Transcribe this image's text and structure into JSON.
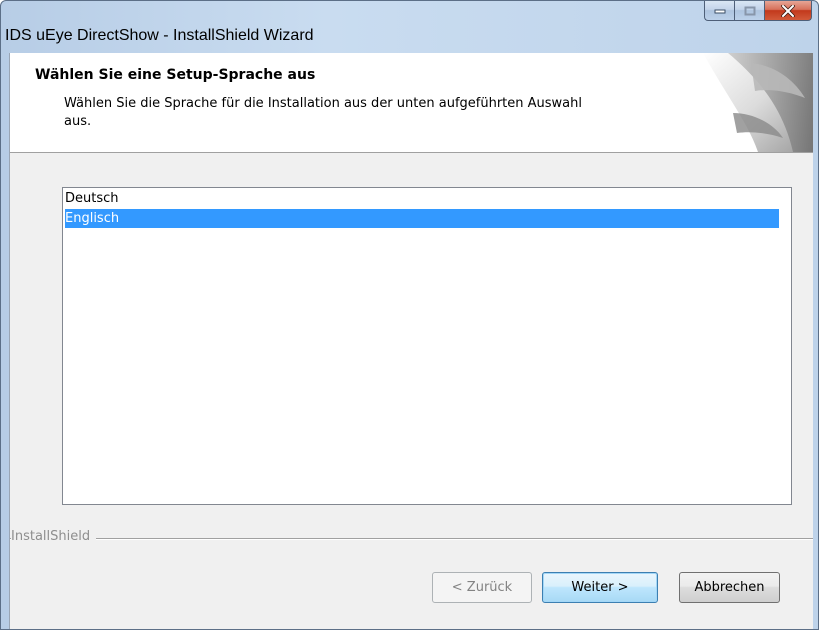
{
  "window": {
    "title": "IDS uEye DirectShow - InstallShield Wizard",
    "buttons": {
      "minimize": "minimize-icon",
      "maximize": "maximize-icon",
      "close": "close-icon"
    }
  },
  "header": {
    "title": "Wählen Sie eine Setup-Sprache aus",
    "description": "Wählen Sie die Sprache für die Installation aus der unten aufgeführten Auswahl aus."
  },
  "language_list": {
    "items": [
      {
        "label": "Deutsch",
        "selected": false
      },
      {
        "label": "Englisch",
        "selected": true
      }
    ]
  },
  "brand": {
    "label": "InstallShield"
  },
  "footer": {
    "back_label": "< Zurück",
    "next_label": "Weiter >",
    "cancel_label": "Abbrechen"
  },
  "colors": {
    "selection": "#3399ff",
    "dialog_bg": "#f0f0f0",
    "close_button": "#c2391c"
  }
}
